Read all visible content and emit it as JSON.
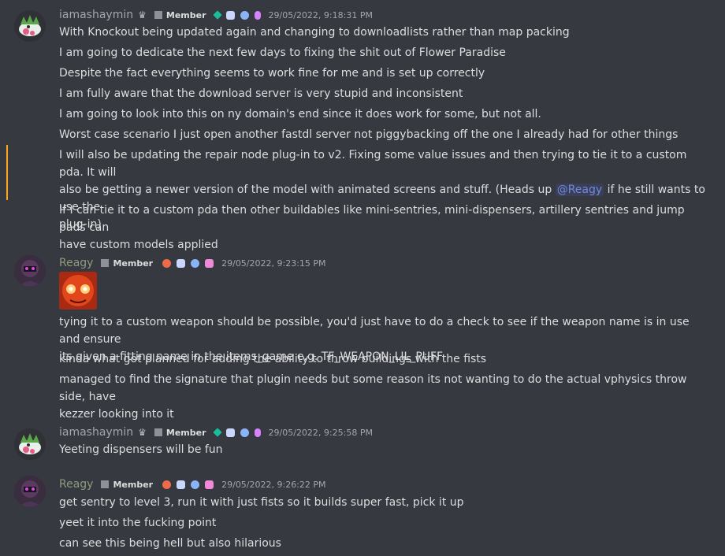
{
  "messages": [
    {
      "author": "iamashaymin",
      "role": "Member",
      "timestamp": "29/05/2022, 9:18:31 PM",
      "lines": [
        "With Knockout being updated again and changing to downloadlists rather than map packing",
        "I am going to dedicate the next few days to fixing the shit out of Flower Paradise",
        "Despite the fact everything seems to work fine for me and is set up correctly",
        "I am fully aware that the download server is very stupid and inconsistent",
        "I am going to look into this on ny domain's end since it does work for some, but not all.",
        "Worst case scenario I just open another fastdl server not piggybacking off the one I already had for other things"
      ],
      "mention_line": {
        "part1": "I will also be updating the repair node plug-in to v2. Fixing some value issues and then trying to tie it to a custom pda. It will",
        "part2": "also be getting a newer version of the model with animated screens and stuff. (Heads up ",
        "mention": "@Reagy",
        "part3": " if he still wants to use the",
        "part4": "plug-in)"
      },
      "last_line": [
        "If I can tie it to a custom pda then other buildables like mini-sentries, mini-dispensers, artillery sentries and jump pads can",
        "have custom models applied"
      ]
    },
    {
      "author": "Reagy",
      "role": "Member",
      "timestamp": "29/05/2022, 9:23:15 PM",
      "lines": [
        "tying it to a custom weapon should be possible, you'd just have to do a check to see if the weapon name is in use and ensure",
        "its given a fitting name in the items_game e.g. TF_WEAPON_LIL_PUFF",
        "kinda what got planned for adding the ability to throw buildings with the fists",
        "managed to find the signature that plugin needs but some reason its not wanting to do the actual vphysics throw side, have",
        "kezzer looking into it"
      ]
    },
    {
      "author": "iamashaymin",
      "role": "Member",
      "timestamp": "29/05/2022, 9:25:58 PM",
      "lines": [
        "Yeeting dispensers will be fun"
      ]
    },
    {
      "author": "Reagy",
      "role": "Member",
      "timestamp": "29/05/2022, 9:26:22 PM",
      "lines": [
        "get sentry to level 3, run it with just fists so it builds super fast, pick it up",
        "yeet it into the fucking point",
        "can see this being hell but also hilarious"
      ]
    }
  ],
  "colors": {
    "background": "#36393f",
    "text": "#dcddde",
    "mention": "#7289da",
    "highlight_bar": "#faa61a",
    "timestamp": "#a3a6aa"
  },
  "icons": {
    "crown": "crown-icon",
    "role": "role-square-icon"
  }
}
